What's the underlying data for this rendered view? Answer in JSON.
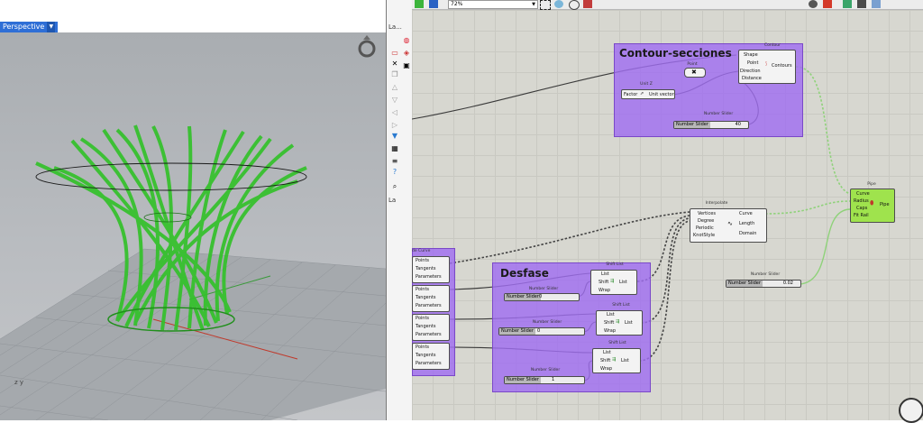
{
  "viewport": {
    "tab_label": "Perspective",
    "axis_label": "z y"
  },
  "layers_panel": {
    "top_label": "La...",
    "bottom_label": "La"
  },
  "gh_toolbar": {
    "zoom": "72%"
  },
  "gh": {
    "contour_group": {
      "title": "Contour-secciones",
      "contour": {
        "caption": "Contour",
        "inputs": [
          "Shape",
          "Point",
          "Direction",
          "Distance"
        ],
        "output": "Contours"
      },
      "point": {
        "caption": "Point"
      },
      "unit_z": {
        "caption": "Unit Z",
        "input": "Factor",
        "output": "Unit vector"
      },
      "slider": {
        "caption": "Number Slider",
        "label": "Number Slider",
        "value": "40"
      }
    },
    "desfase_group": {
      "title": "Desfase",
      "shift1": {
        "caption": "Shift List",
        "inputs": [
          "List",
          "Shift",
          "Wrap"
        ],
        "output": "List"
      },
      "slider1": {
        "caption": "Number Slider",
        "label": "Number Slider",
        "value": "0"
      },
      "shift2": {
        "caption": "Shift List",
        "inputs": [
          "List",
          "Shift",
          "Wrap"
        ],
        "output": "List"
      },
      "slider2": {
        "caption": "Number Slider",
        "label": "Number Slider",
        "value": "0"
      },
      "shift3": {
        "caption": "Shift List",
        "inputs": [
          "List",
          "Shift",
          "Wrap"
        ],
        "output": "List"
      },
      "slider3": {
        "caption": "Number Slider",
        "label": "Number Slider",
        "value": "1"
      }
    },
    "de_curve_group": {
      "caption": "de Curve",
      "blocks": [
        [
          "Points",
          "Tangents",
          "Parameters"
        ],
        [
          "Points",
          "Tangents",
          "Parameters"
        ],
        [
          "Points",
          "Tangents",
          "Parameters"
        ],
        [
          "Points",
          "Tangents",
          "Parameters"
        ]
      ]
    },
    "interpolate": {
      "caption": "Interpolate",
      "inputs": [
        "Vertices",
        "Degree",
        "Periodic",
        "KnotStyle"
      ],
      "outputs": [
        "Curve",
        "Length",
        "Domain"
      ]
    },
    "pipe": {
      "caption": "Pipe",
      "inputs": [
        "Curve",
        "Radius",
        "Caps",
        "Fit Rail"
      ],
      "output": "Pipe"
    },
    "pipe_slider": {
      "caption": "Number Slider",
      "label": "Number Slider",
      "value": "0.02"
    }
  },
  "colors": {
    "group_purple": "#a06ef0",
    "pipe_green": "#9fe34d",
    "wire_green": "#8fd27a",
    "geometry_green": "#33c12a"
  }
}
